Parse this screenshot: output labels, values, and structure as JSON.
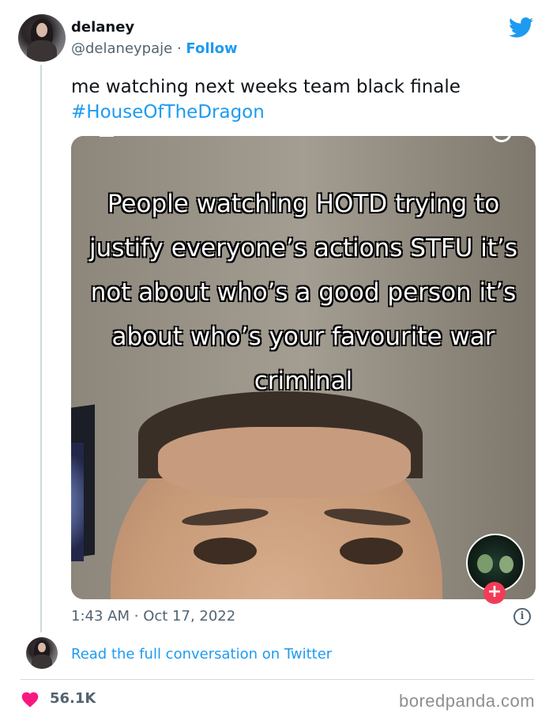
{
  "tweet": {
    "author_name": "delaney",
    "handle": "@delaneypaje",
    "separator": "·",
    "follow_label": "Follow",
    "text": "me watching next weeks team black finale",
    "hashtag": "#HouseOfTheDragon",
    "media_overlay_text": "People watching HOTD trying to justify everyone’s actions STFU it’s not about who’s a good person it’s about who’s your favourite war criminal",
    "time": "1:43 AM",
    "date": "Oct 17, 2022",
    "read_conversation_label": "Read the full conversation on Twitter",
    "likes": "56.1K"
  },
  "media": {
    "plus_badge": "+"
  },
  "info_icon_glyph": "i",
  "watermark": "boredpanda.com",
  "colors": {
    "link": "#1d9bf0",
    "text": "#0f1419",
    "secondary": "#536471",
    "heart": "#f91880",
    "tiktok_plus": "#f23c57"
  },
  "icons": [
    "twitter-bird-icon",
    "info-icon",
    "heart-icon",
    "plus-icon",
    "back-chevron-icon",
    "search-icon"
  ]
}
